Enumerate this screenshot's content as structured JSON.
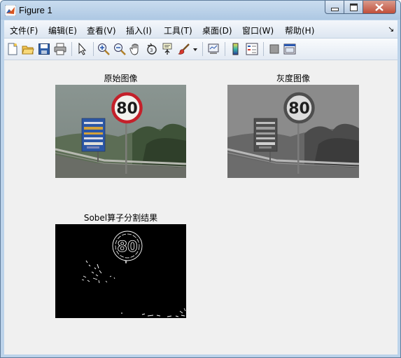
{
  "window": {
    "title": "Figure 1"
  },
  "menu": [
    "文件(F)",
    "编辑(E)",
    "查看(V)",
    "插入(I)",
    "工具(T)",
    "桌面(D)",
    "窗口(W)",
    "帮助(H)"
  ],
  "toolbar": [
    "new-figure-icon",
    "open-folder-icon",
    "save-icon",
    "print-icon",
    "pointer-icon",
    "zoom-in-icon",
    "zoom-out-icon",
    "pan-hand-icon",
    "rotate-3d-icon",
    "data-cursor-icon",
    "brush-icon",
    "brush-dropdown-icon",
    "link-plot-icon",
    "colorbar-icon",
    "legend-icon",
    "hide-plot-tools-icon",
    "show-plot-tools-icon"
  ],
  "subplots": [
    {
      "title": "原始图像",
      "kind": "color-photo",
      "sign_text": "80"
    },
    {
      "title": "灰度图像",
      "kind": "grayscale-photo",
      "sign_text": "80"
    },
    {
      "title": "Sobel算子分割结果",
      "kind": "edge-map",
      "sign_text": "80"
    }
  ],
  "colors": {
    "title_bar": "#aec8e3",
    "client_bg": "#f0f0f0",
    "close_button": "#c1503a",
    "sign_ring": "#c4202a"
  }
}
